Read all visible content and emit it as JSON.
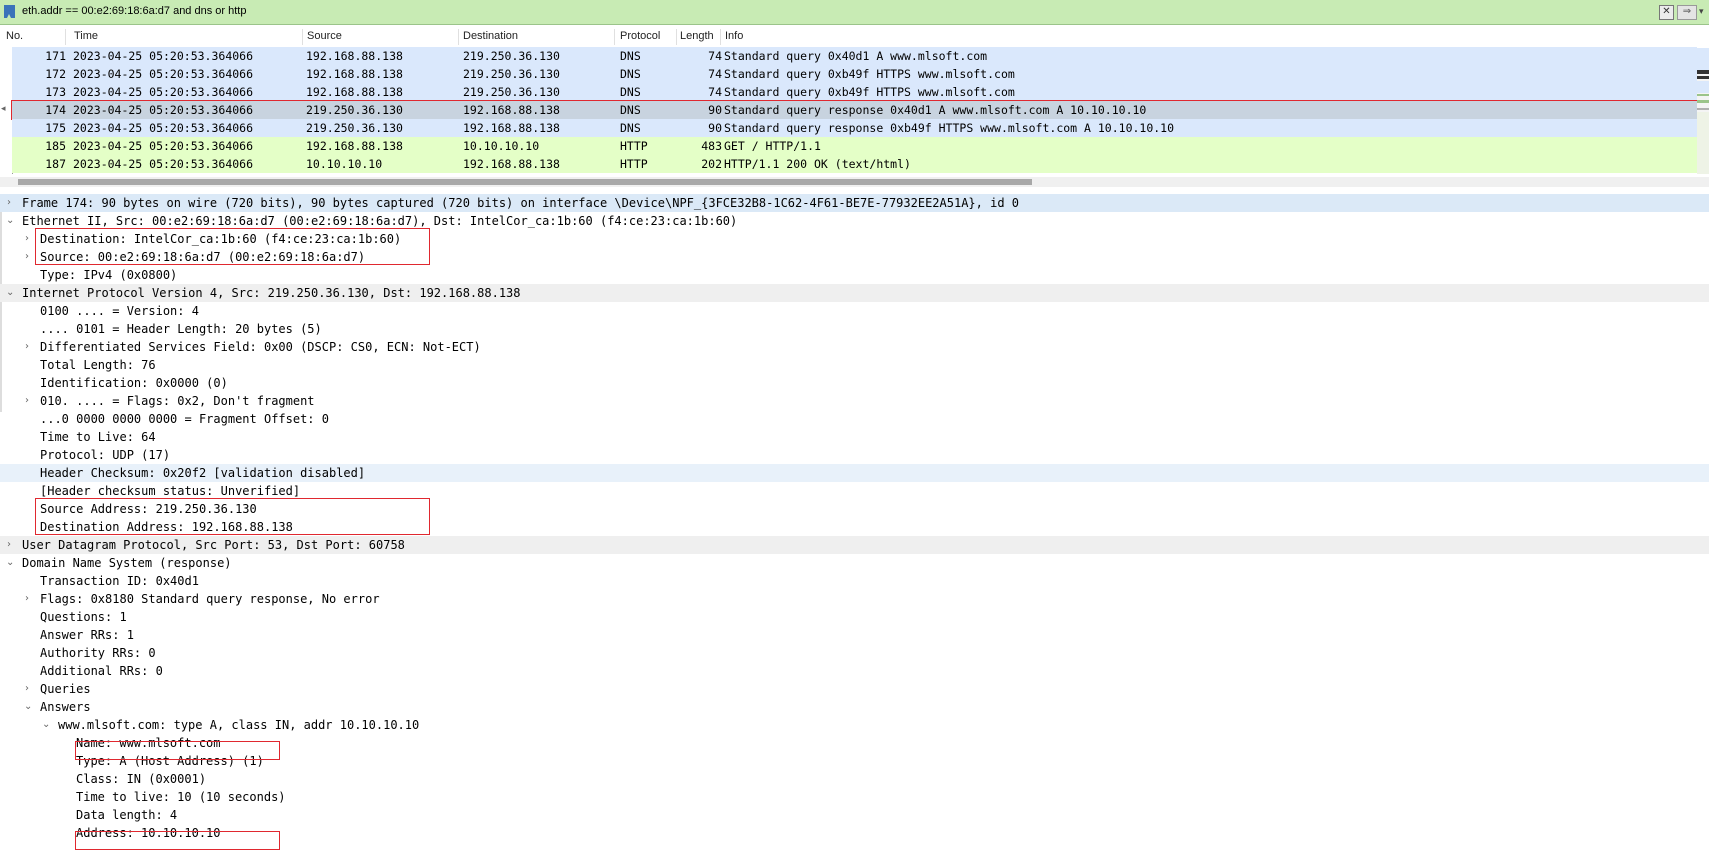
{
  "filter": {
    "value": "eth.addr == 00:e2:69:18:6a:d7 and dns or http",
    "bookmark_icon": "bookmark-icon",
    "clear_icon": "clear-icon",
    "apply_icon": "apply-arrow-icon",
    "dropdown_icon": "chevron-down-icon"
  },
  "columns": [
    "No.",
    "Time",
    "Source",
    "Destination",
    "Protocol",
    "Length",
    "Info"
  ],
  "packets": [
    {
      "no": "171",
      "time": "2023-04-25 05:20:53.364066",
      "src": "192.168.88.138",
      "dst": "219.250.36.130",
      "proto": "DNS",
      "len": "74",
      "info": "Standard query 0x40d1 A www.mlsoft.com"
    },
    {
      "no": "172",
      "time": "2023-04-25 05:20:53.364066",
      "src": "192.168.88.138",
      "dst": "219.250.36.130",
      "proto": "DNS",
      "len": "74",
      "info": "Standard query 0xb49f HTTPS www.mlsoft.com"
    },
    {
      "no": "173",
      "time": "2023-04-25 05:20:53.364066",
      "src": "192.168.88.138",
      "dst": "219.250.36.130",
      "proto": "DNS",
      "len": "74",
      "info": "Standard query 0xb49f HTTPS www.mlsoft.com"
    },
    {
      "no": "174",
      "time": "2023-04-25 05:20:53.364066",
      "src": "219.250.36.130",
      "dst": "192.168.88.138",
      "proto": "DNS",
      "len": "90",
      "info": "Standard query response 0x40d1 A www.mlsoft.com A 10.10.10.10"
    },
    {
      "no": "175",
      "time": "2023-04-25 05:20:53.364066",
      "src": "219.250.36.130",
      "dst": "192.168.88.138",
      "proto": "DNS",
      "len": "90",
      "info": "Standard query response 0xb49f HTTPS www.mlsoft.com A 10.10.10.10"
    },
    {
      "no": "185",
      "time": "2023-04-25 05:20:53.364066",
      "src": "192.168.88.138",
      "dst": "10.10.10.10",
      "proto": "HTTP",
      "len": "483",
      "info": "GET / HTTP/1.1"
    },
    {
      "no": "187",
      "time": "2023-04-25 05:20:53.364066",
      "src": "10.10.10.10",
      "dst": "192.168.88.138",
      "proto": "HTTP",
      "len": "202",
      "info": "HTTP/1.1 200 OK  (text/html)"
    }
  ],
  "details": {
    "frame": "Frame 174: 90 bytes on wire (720 bits), 90 bytes captured (720 bits) on interface \\Device\\NPF_{3FCE32B8-1C62-4F61-BE7E-77932EE2A51A}, id 0",
    "eth": "Ethernet II, Src: 00:e2:69:18:6a:d7 (00:e2:69:18:6a:d7), Dst: IntelCor_ca:1b:60 (f4:ce:23:ca:1b:60)",
    "eth_dst": "Destination: IntelCor_ca:1b:60 (f4:ce:23:ca:1b:60)",
    "eth_src": "Source: 00:e2:69:18:6a:d7 (00:e2:69:18:6a:d7)",
    "eth_type": "Type: IPv4 (0x0800)",
    "ip": "Internet Protocol Version 4, Src: 219.250.36.130, Dst: 192.168.88.138",
    "ip_version": "0100 .... = Version: 4",
    "ip_hlen": ".... 0101 = Header Length: 20 bytes (5)",
    "ip_dsf": "Differentiated Services Field: 0x00 (DSCP: CS0, ECN: Not-ECT)",
    "ip_totlen": "Total Length: 76",
    "ip_id": "Identification: 0x0000 (0)",
    "ip_flags": "010. .... = Flags: 0x2, Don't fragment",
    "ip_frag": "...0 0000 0000 0000 = Fragment Offset: 0",
    "ip_ttl": "Time to Live: 64",
    "ip_proto": "Protocol: UDP (17)",
    "ip_cksum": "Header Checksum: 0x20f2 [validation disabled]",
    "ip_cksum_status": "[Header checksum status: Unverified]",
    "ip_src": "Source Address: 219.250.36.130",
    "ip_dst": "Destination Address: 192.168.88.138",
    "udp": "User Datagram Protocol, Src Port: 53, Dst Port: 60758",
    "dns": "Domain Name System (response)",
    "dns_txid": "Transaction ID: 0x40d1",
    "dns_flags": "Flags: 0x8180 Standard query response, No error",
    "dns_q": "Questions: 1",
    "dns_ans": "Answer RRs: 1",
    "dns_auth": "Authority RRs: 0",
    "dns_add": "Additional RRs: 0",
    "dns_queries": "Queries",
    "dns_answers": "Answers",
    "ans_rr": "www.mlsoft.com: type A, class IN, addr 10.10.10.10",
    "ans_name": "Name: www.mlsoft.com",
    "ans_type": "Type: A (Host Address) (1)",
    "ans_class": "Class: IN (0x0001)",
    "ans_ttl": "Time to live: 10 (10 seconds)",
    "ans_dlen": "Data length: 4",
    "ans_addr": "Address: 10.10.10.10"
  },
  "colors": {
    "dns_row": "#dae8fc",
    "http_row": "#e4ffc7",
    "selected_row": "#c8d3df",
    "highlight_box": "#e0282f",
    "filter_bg": "#c8ebb4"
  }
}
